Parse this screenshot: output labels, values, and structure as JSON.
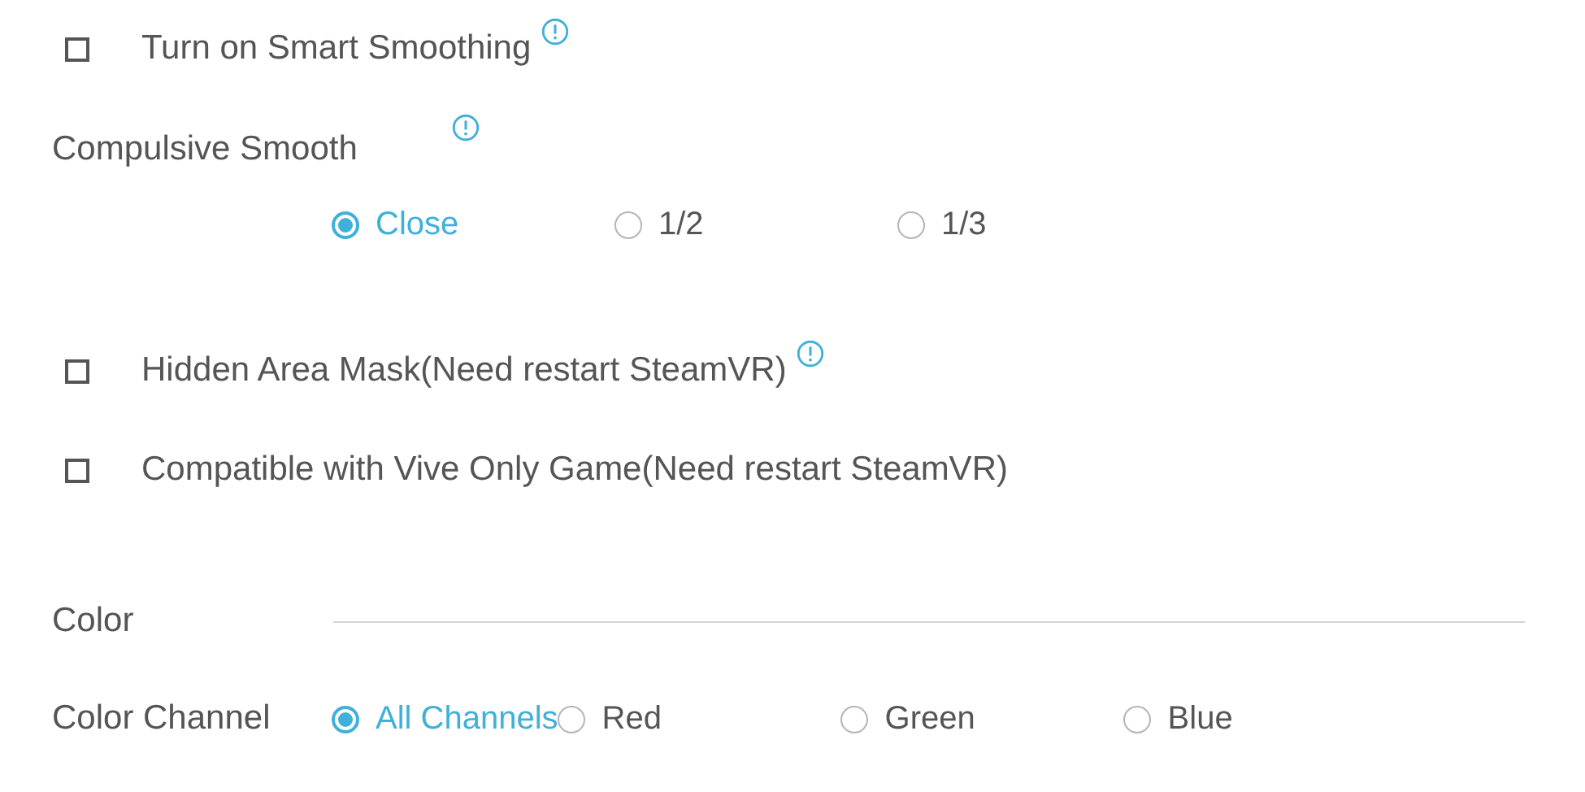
{
  "items": [
    {
      "kind": "checkbox",
      "label": "Turn on Smart Smoothing",
      "checked": false,
      "info": true
    },
    {
      "kind": "radio_stacked",
      "label": "Compulsive Smooth",
      "info": true,
      "options": [
        {
          "label": "Close",
          "selected": true
        },
        {
          "label": "1/2",
          "selected": false
        },
        {
          "label": "1/3",
          "selected": false
        }
      ]
    },
    {
      "kind": "checkbox",
      "label": "Hidden Area Mask(Need restart SteamVR)",
      "checked": false,
      "info": true
    },
    {
      "kind": "checkbox",
      "label": "Compatible with Vive Only Game(Need restart SteamVR)",
      "checked": false,
      "info": false
    },
    {
      "kind": "section",
      "label": "Color"
    },
    {
      "kind": "radio_inline",
      "label": "Color Channel",
      "info": false,
      "options": [
        {
          "label": "All Channels",
          "selected": true
        },
        {
          "label": "Red",
          "selected": false
        },
        {
          "label": "Green",
          "selected": false
        },
        {
          "label": "Blue",
          "selected": false
        }
      ]
    }
  ]
}
